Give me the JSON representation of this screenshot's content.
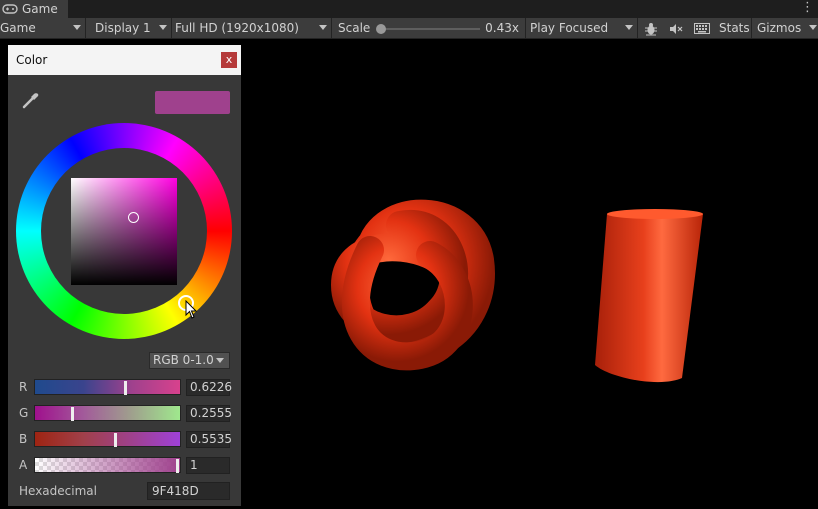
{
  "tab": {
    "title": "Game",
    "icon": "gamepad-icon"
  },
  "toolbar": {
    "game_view": "Game",
    "display": "Display 1",
    "resolution": "Full HD (1920x1080)",
    "scale_label": "Scale",
    "scale_value": "0.43x",
    "play_mode": "Play Focused",
    "stats": "Stats",
    "gizmos": "Gizmos"
  },
  "color_picker": {
    "title": "Color",
    "close": "x",
    "current_color": "#9f418d",
    "mode": "RGB 0-1.0",
    "channels": [
      {
        "label": "R",
        "value": "0.6226"
      },
      {
        "label": "G",
        "value": "0.2555"
      },
      {
        "label": "B",
        "value": "0.5535"
      },
      {
        "label": "A",
        "value": "1"
      }
    ],
    "hex_label": "Hexadecimal",
    "hex_value": "9F418D"
  },
  "scene": {
    "objects": [
      "torus-knot",
      "cylinder"
    ],
    "object_color": "#e33212"
  }
}
